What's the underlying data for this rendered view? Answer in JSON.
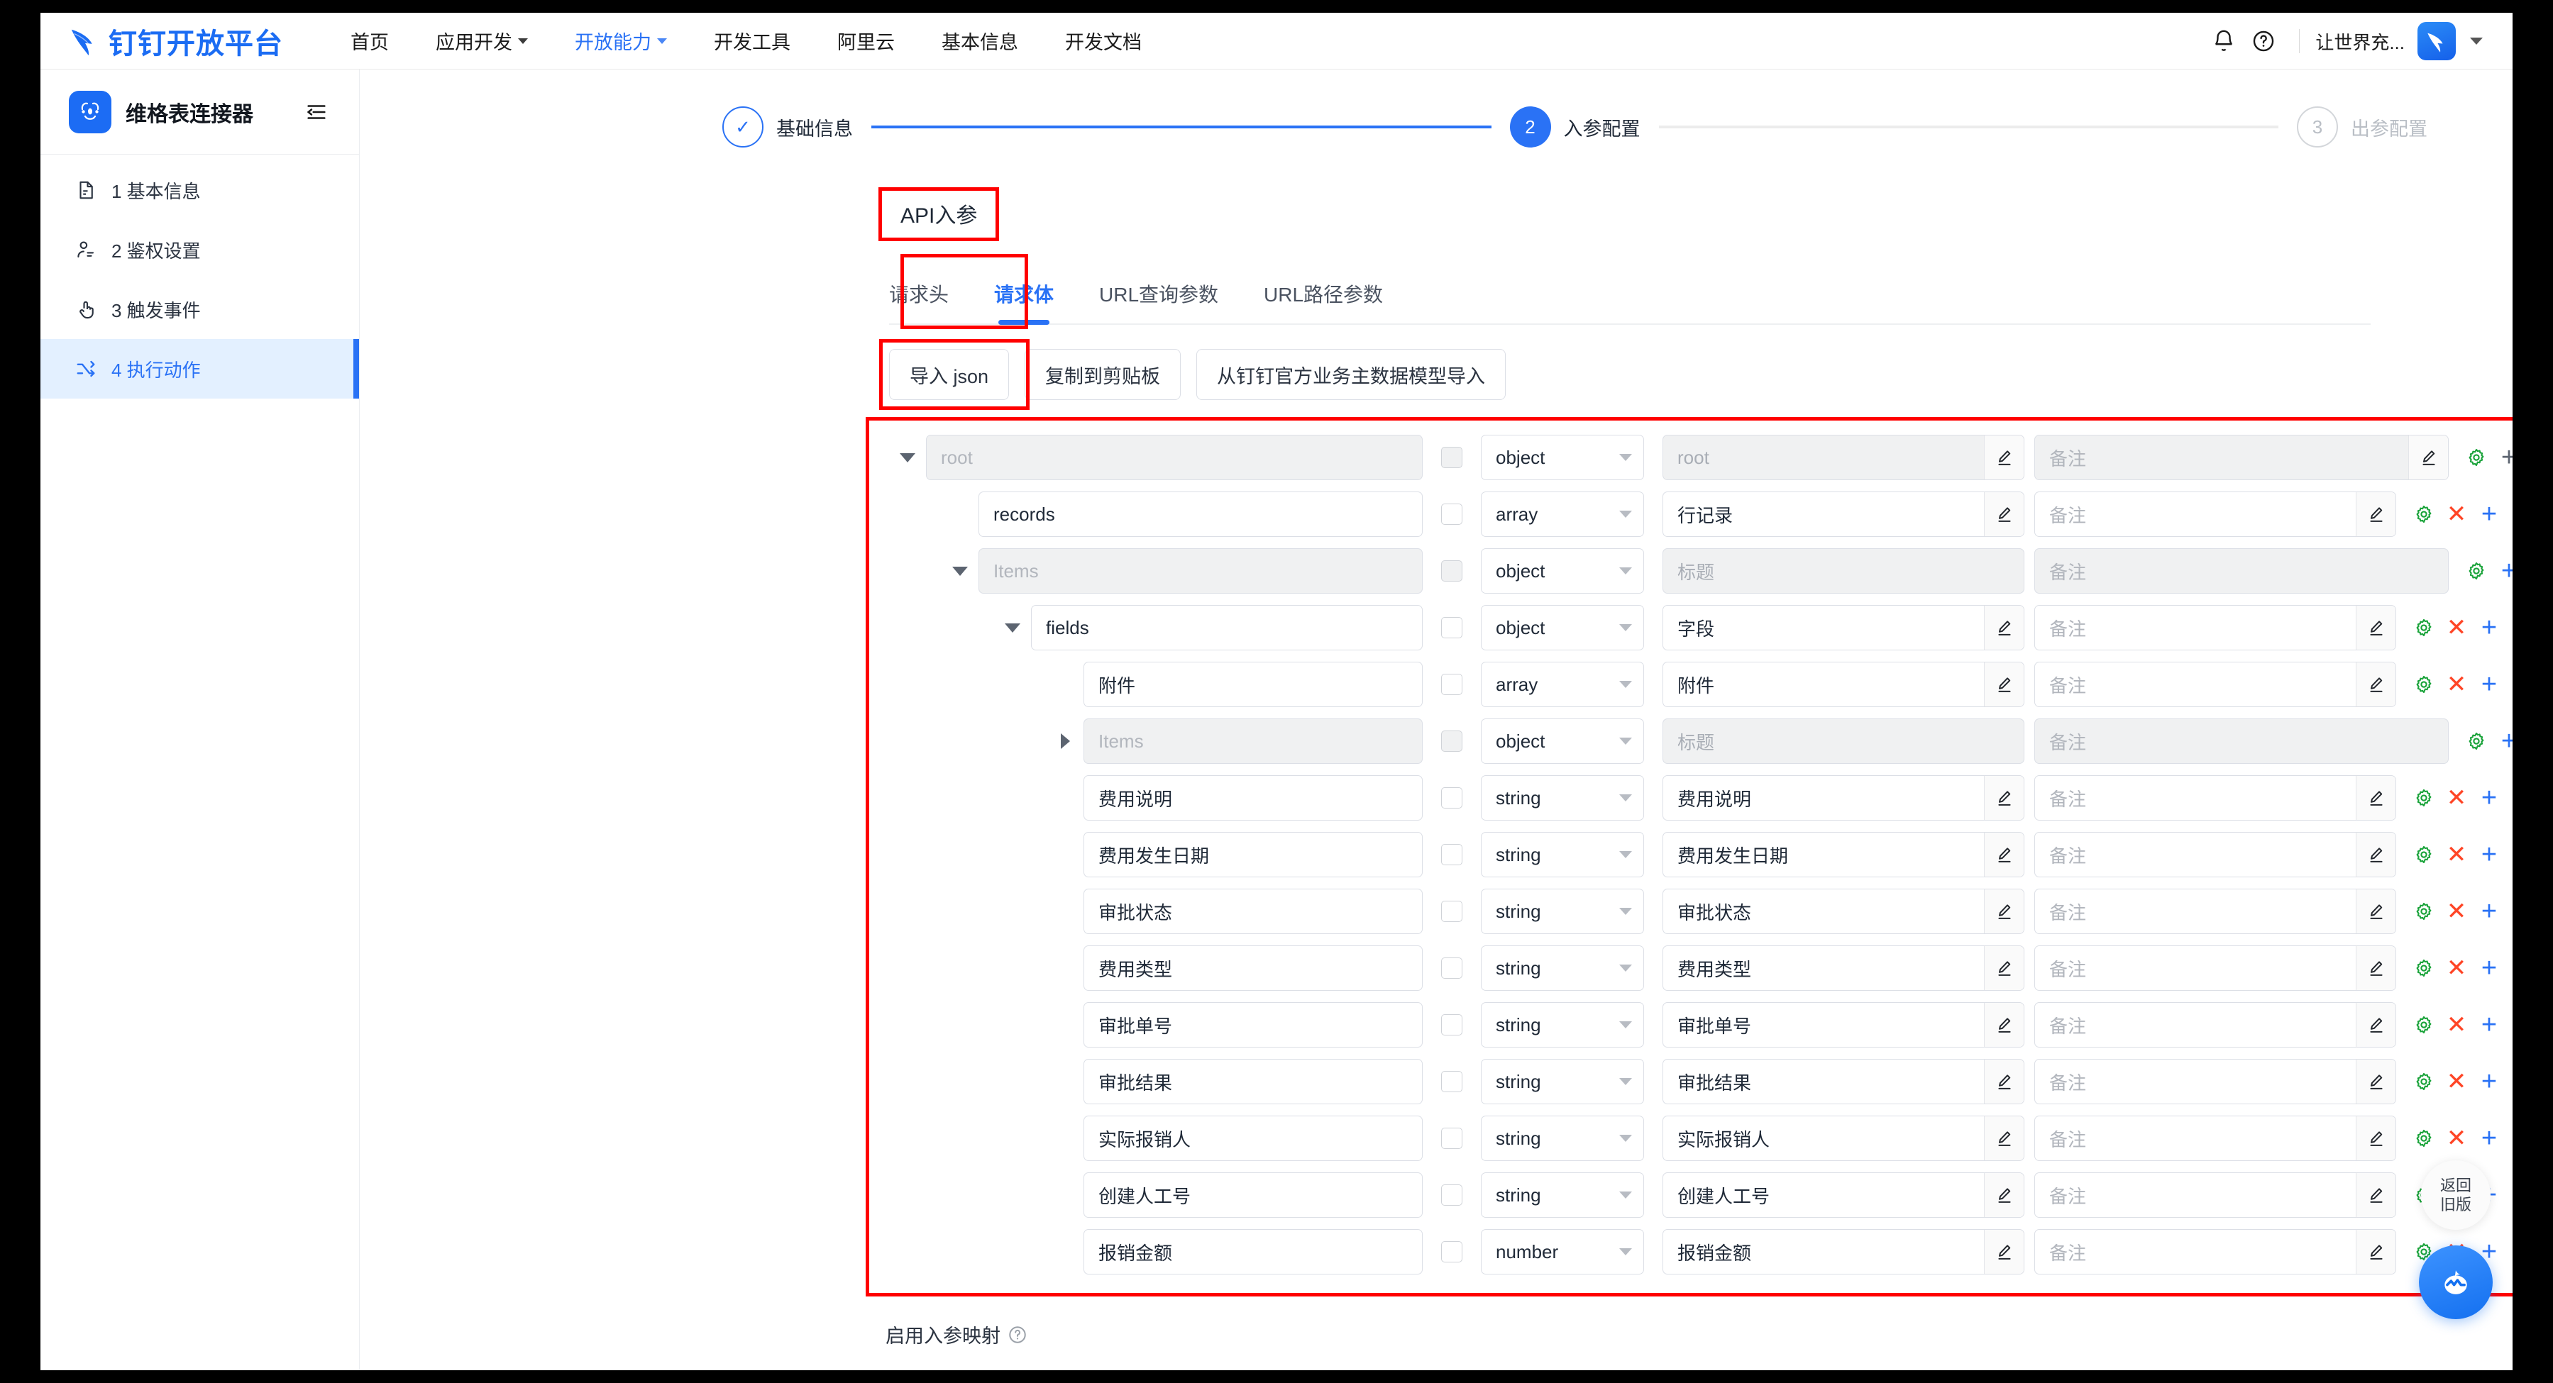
{
  "nav": {
    "brand": "钉钉开放平台",
    "brand_color": "#1b6cf3",
    "items": [
      {
        "label": "首页",
        "caret": false,
        "active": false
      },
      {
        "label": "应用开发",
        "caret": true,
        "active": false
      },
      {
        "label": "开放能力",
        "caret": true,
        "active": true
      },
      {
        "label": "开发工具",
        "caret": false,
        "active": false
      },
      {
        "label": "阿里云",
        "caret": false,
        "active": false
      },
      {
        "label": "基本信息",
        "caret": false,
        "active": false
      },
      {
        "label": "开发文档",
        "caret": false,
        "active": false
      }
    ],
    "bell_icon": "bell-icon",
    "help_icon": "question-circle-icon",
    "user_name": "让世界充...",
    "avatar_icon": "dingtalk-logo-icon"
  },
  "sidebar": {
    "app_name": "维格表连接器",
    "collapse_icon": "collapse-sidebar-icon",
    "items": [
      {
        "label": "1 基本信息",
        "icon": "document-icon",
        "active": false
      },
      {
        "label": "2 鉴权设置",
        "icon": "user-auth-icon",
        "active": false
      },
      {
        "label": "3 触发事件",
        "icon": "hand-click-icon",
        "active": false
      },
      {
        "label": "4 执行动作",
        "icon": "branch-action-icon",
        "active": true
      }
    ]
  },
  "steps": [
    {
      "mark": "✓",
      "label": "基础信息",
      "state": "done"
    },
    {
      "mark": "2",
      "label": "入参配置",
      "state": "current"
    },
    {
      "mark": "3",
      "label": "出参配置",
      "state": "todo"
    }
  ],
  "section": {
    "api_title": "API入参",
    "tabs": [
      {
        "label": "请求头",
        "active": false
      },
      {
        "label": "请求体",
        "active": true
      },
      {
        "label": "URL查询参数",
        "active": false
      },
      {
        "label": "URL路径参数",
        "active": false
      }
    ],
    "buttons": [
      {
        "label": "导入 json",
        "highlighted": true
      },
      {
        "label": "复制到剪贴板",
        "highlighted": false
      },
      {
        "label": "从钉钉官方业务主数据模型导入",
        "highlighted": false
      }
    ]
  },
  "table": {
    "placeholders": {
      "name": "root",
      "items": "Items",
      "title": "标题",
      "remark": "备注"
    },
    "rows": [
      {
        "indent": 0,
        "toggle": "down",
        "name": "root",
        "name_is_placeholder": true,
        "disabled": true,
        "type": "object",
        "title": "root",
        "title_is_placeholder": false,
        "remark": "备注",
        "pencil_title": true,
        "pencil_remark": true,
        "has_delete": false,
        "plus_color": "gray"
      },
      {
        "indent": 1,
        "toggle": "none",
        "name": "records",
        "name_is_placeholder": false,
        "disabled": false,
        "type": "array",
        "title": "行记录",
        "title_is_placeholder": false,
        "remark": "备注",
        "pencil_title": true,
        "pencil_remark": true,
        "has_delete": true,
        "plus_color": "blue"
      },
      {
        "indent": 1,
        "toggle": "down",
        "name": "Items",
        "name_is_placeholder": true,
        "disabled": true,
        "type": "object",
        "title": "标题",
        "title_is_placeholder": true,
        "remark": "备注",
        "pencil_title": false,
        "pencil_remark": false,
        "has_delete": false,
        "plus_color": "blue"
      },
      {
        "indent": 2,
        "toggle": "down",
        "name": "fields",
        "name_is_placeholder": false,
        "disabled": false,
        "type": "object",
        "title": "字段",
        "title_is_placeholder": false,
        "remark": "备注",
        "pencil_title": true,
        "pencil_remark": true,
        "has_delete": true,
        "plus_color": "blue"
      },
      {
        "indent": 3,
        "toggle": "none",
        "name": "附件",
        "name_is_placeholder": false,
        "disabled": false,
        "type": "array",
        "title": "附件",
        "title_is_placeholder": false,
        "remark": "备注",
        "pencil_title": true,
        "pencil_remark": true,
        "has_delete": true,
        "plus_color": "blue"
      },
      {
        "indent": 3,
        "toggle": "right",
        "name": "Items",
        "name_is_placeholder": true,
        "disabled": true,
        "type": "object",
        "title": "标题",
        "title_is_placeholder": true,
        "remark": "备注",
        "pencil_title": false,
        "pencil_remark": false,
        "has_delete": false,
        "plus_color": "blue"
      },
      {
        "indent": 3,
        "toggle": "none",
        "name": "费用说明",
        "name_is_placeholder": false,
        "disabled": false,
        "type": "string",
        "title": "费用说明",
        "title_is_placeholder": false,
        "remark": "备注",
        "pencil_title": true,
        "pencil_remark": true,
        "has_delete": true,
        "plus_color": "blue"
      },
      {
        "indent": 3,
        "toggle": "none",
        "name": "费用发生日期",
        "name_is_placeholder": false,
        "disabled": false,
        "type": "string",
        "title": "费用发生日期",
        "title_is_placeholder": false,
        "remark": "备注",
        "pencil_title": true,
        "pencil_remark": true,
        "has_delete": true,
        "plus_color": "blue"
      },
      {
        "indent": 3,
        "toggle": "none",
        "name": "审批状态",
        "name_is_placeholder": false,
        "disabled": false,
        "type": "string",
        "title": "审批状态",
        "title_is_placeholder": false,
        "remark": "备注",
        "pencil_title": true,
        "pencil_remark": true,
        "has_delete": true,
        "plus_color": "blue"
      },
      {
        "indent": 3,
        "toggle": "none",
        "name": "费用类型",
        "name_is_placeholder": false,
        "disabled": false,
        "type": "string",
        "title": "费用类型",
        "title_is_placeholder": false,
        "remark": "备注",
        "pencil_title": true,
        "pencil_remark": true,
        "has_delete": true,
        "plus_color": "blue"
      },
      {
        "indent": 3,
        "toggle": "none",
        "name": "审批单号",
        "name_is_placeholder": false,
        "disabled": false,
        "type": "string",
        "title": "审批单号",
        "title_is_placeholder": false,
        "remark": "备注",
        "pencil_title": true,
        "pencil_remark": true,
        "has_delete": true,
        "plus_color": "blue"
      },
      {
        "indent": 3,
        "toggle": "none",
        "name": "审批结果",
        "name_is_placeholder": false,
        "disabled": false,
        "type": "string",
        "title": "审批结果",
        "title_is_placeholder": false,
        "remark": "备注",
        "pencil_title": true,
        "pencil_remark": true,
        "has_delete": true,
        "plus_color": "blue"
      },
      {
        "indent": 3,
        "toggle": "none",
        "name": "实际报销人",
        "name_is_placeholder": false,
        "disabled": false,
        "type": "string",
        "title": "实际报销人",
        "title_is_placeholder": false,
        "remark": "备注",
        "pencil_title": true,
        "pencil_remark": true,
        "has_delete": true,
        "plus_color": "blue"
      },
      {
        "indent": 3,
        "toggle": "none",
        "name": "创建人工号",
        "name_is_placeholder": false,
        "disabled": false,
        "type": "string",
        "title": "创建人工号",
        "title_is_placeholder": false,
        "remark": "备注",
        "pencil_title": true,
        "pencil_remark": true,
        "has_delete": true,
        "plus_color": "blue"
      },
      {
        "indent": 3,
        "toggle": "none",
        "name": "报销金额",
        "name_is_placeholder": false,
        "disabled": false,
        "type": "number",
        "title": "报销金额",
        "title_is_placeholder": false,
        "remark": "备注",
        "pencil_title": true,
        "pencil_remark": true,
        "has_delete": true,
        "plus_color": "blue"
      }
    ],
    "action_icons": {
      "gear": "gear-icon",
      "delete": "✕",
      "add": "+"
    }
  },
  "bottom": {
    "mapping_label": "启用入参映射",
    "help_icon": "question-circle-icon"
  },
  "float": {
    "back_line1": "返回",
    "back_line2": "旧版",
    "chat_icon": "chat-assistant-icon"
  },
  "colors": {
    "accent": "#2a72f5",
    "annotation": "#ff0000",
    "delete": "#ff4526",
    "gear": "#1aa33a"
  }
}
